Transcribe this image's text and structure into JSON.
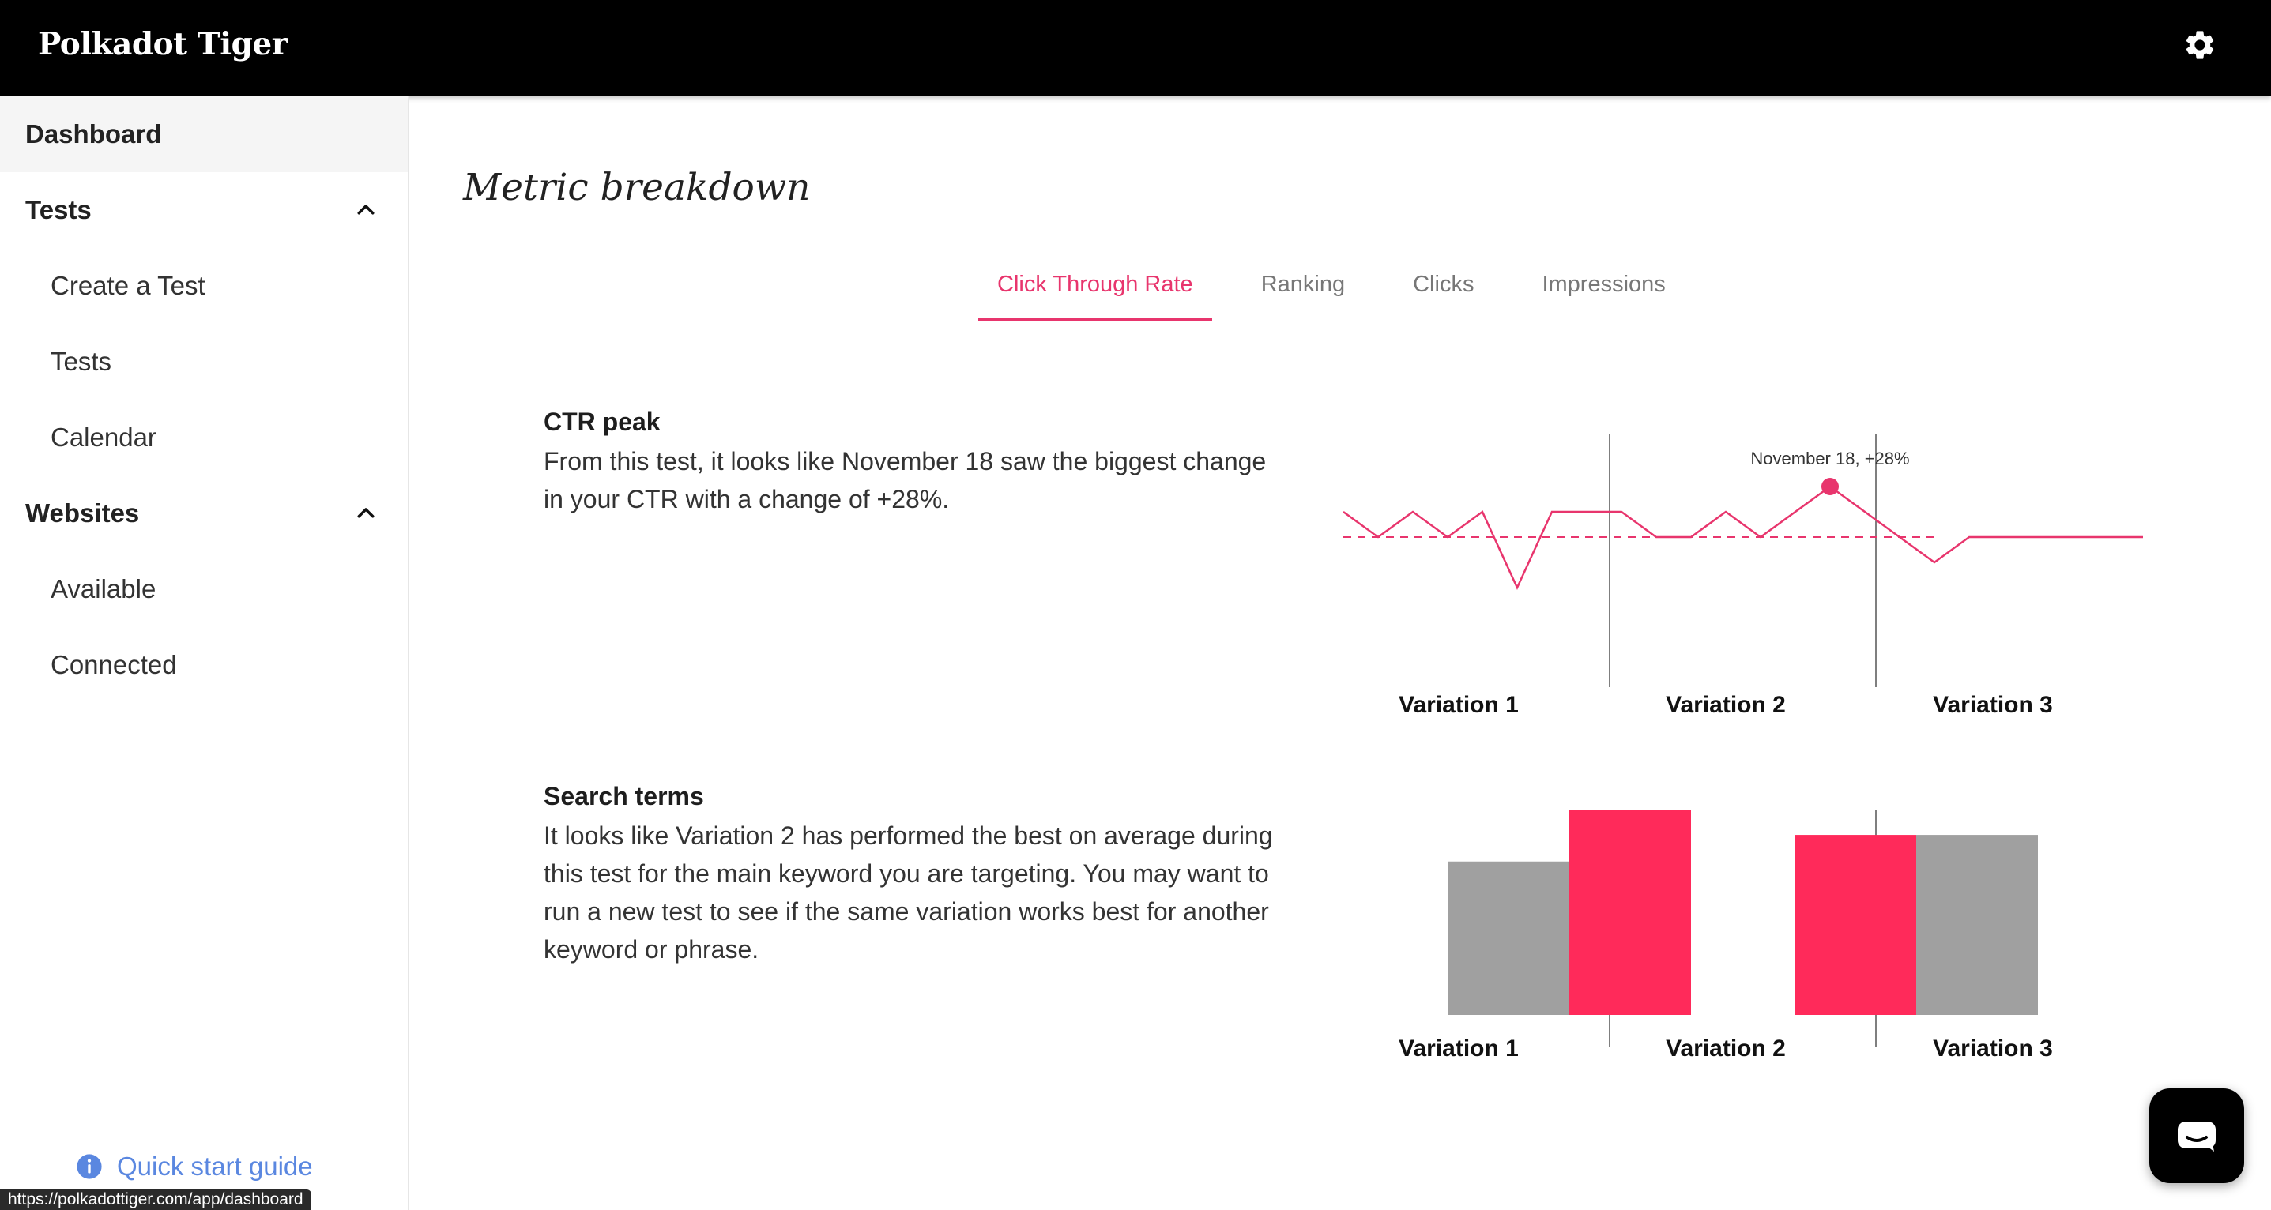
{
  "header": {
    "brand": "Polkadot Tiger",
    "settings_icon": "gear-icon"
  },
  "sidebar": {
    "dashboard": "Dashboard",
    "tests_section": "Tests",
    "create_test": "Create a Test",
    "tests": "Tests",
    "calendar": "Calendar",
    "websites_section": "Websites",
    "available": "Available",
    "connected": "Connected",
    "quick_start": "Quick start guide"
  },
  "status_url": "https://polkadottiger.com/app/dashboard",
  "main": {
    "title": "Metric breakdown",
    "tabs": [
      {
        "label": "Click Through Rate",
        "active": true
      },
      {
        "label": "Ranking",
        "active": false
      },
      {
        "label": "Clicks",
        "active": false
      },
      {
        "label": "Impressions",
        "active": false
      }
    ],
    "ctr_section": {
      "title": "CTR peak",
      "body": "From this test, it looks like November 18 saw the biggest change in your CTR with a change of +28%."
    },
    "terms_section": {
      "title": "Search terms",
      "body": "It looks like Variation 2 has performed the best on average during this test for the main keyword you are targeting. You may want to run a new test to see if the same variation works best for another keyword or phrase."
    }
  },
  "colors": {
    "accent": "#e8356d",
    "bar_accent": "#ff2a5a",
    "bar_neutral": "#a0a0a0",
    "header_bg": "#000000"
  },
  "chart_data": [
    {
      "type": "line",
      "annotation": "November 18, +28%",
      "categories": [
        "Variation 1",
        "Variation 2",
        "Variation 3"
      ],
      "baseline": 0,
      "values": [
        1,
        0,
        1,
        0,
        1,
        -2,
        1,
        1,
        1,
        0,
        0,
        1,
        0,
        1,
        2,
        1,
        0,
        -1,
        0,
        0,
        0,
        0,
        0,
        0
      ],
      "peak_index": 14
    },
    {
      "type": "bar",
      "categories": [
        "Variation 1",
        "Variation 2",
        "Variation 3"
      ],
      "series": [
        {
          "values": [
            0.75,
            1.0
          ]
        },
        {
          "values": [
            0.88,
            0.88
          ]
        }
      ]
    }
  ]
}
